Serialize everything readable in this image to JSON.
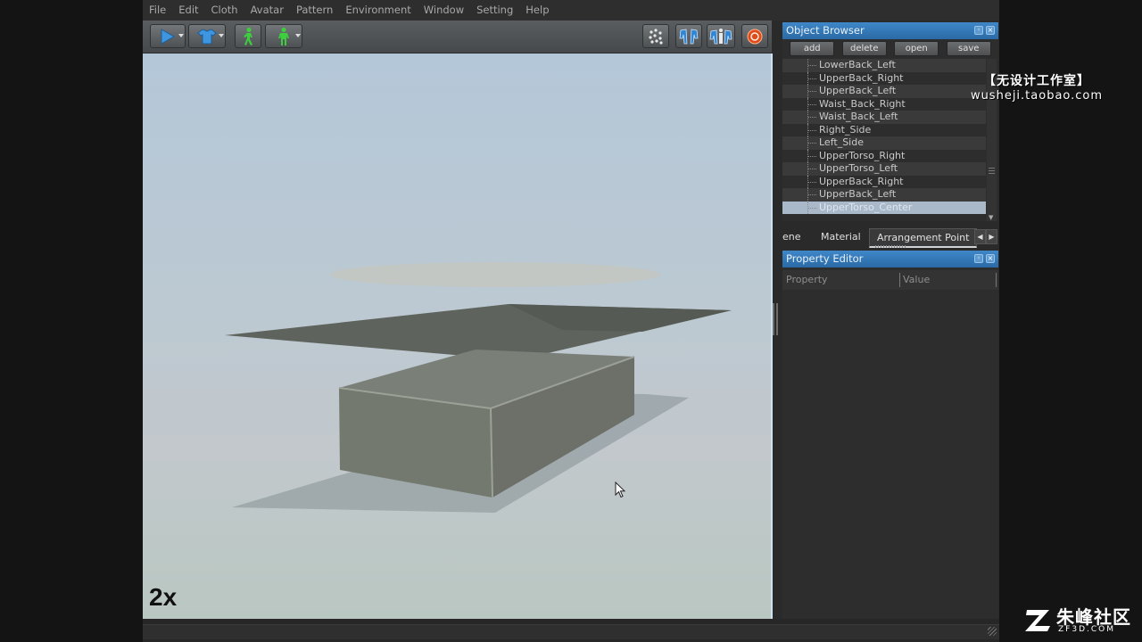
{
  "menu": [
    "File",
    "Edit",
    "Cloth",
    "Avatar",
    "Pattern",
    "Environment",
    "Window",
    "Setting",
    "Help"
  ],
  "toolbar": {
    "left_icons": [
      "play-icon",
      "shirt-icon",
      "walk-icon",
      "avatar-icon"
    ],
    "right_icons": [
      "particle-icon",
      "cloth-pair-icon",
      "avatar-pair-icon",
      "record-icon"
    ]
  },
  "viewport": {
    "speed_label": "2x"
  },
  "object_browser": {
    "title": "Object Browser",
    "buttons": [
      "add",
      "delete",
      "open",
      "save"
    ],
    "items": [
      "LowerBack_Left",
      "UpperBack_Right",
      "UpperBack_Left",
      "Waist_Back_Right",
      "Waist_Back_Left",
      "Right_Side",
      "Left_Side",
      "UpperTorso_Right",
      "UpperTorso_Left",
      "UpperBack_Right",
      "UpperBack_Left",
      "UpperTorso_Center"
    ],
    "selected_index": 11
  },
  "tabs": [
    "ene",
    "Material",
    "Arrangement Point"
  ],
  "property_editor": {
    "title": "Property Editor",
    "columns": [
      "Property",
      "Value"
    ]
  },
  "watermarks": {
    "studio_name": "【无设计工作室】",
    "studio_url": "wusheji.taobao.com",
    "community_name": "朱峰社区",
    "community_url": "ZF3D.COM"
  },
  "colors": {
    "panel_header": "#2f73b3",
    "viewport_top": "#b4c7d8",
    "selection": "#a9b9c9"
  }
}
